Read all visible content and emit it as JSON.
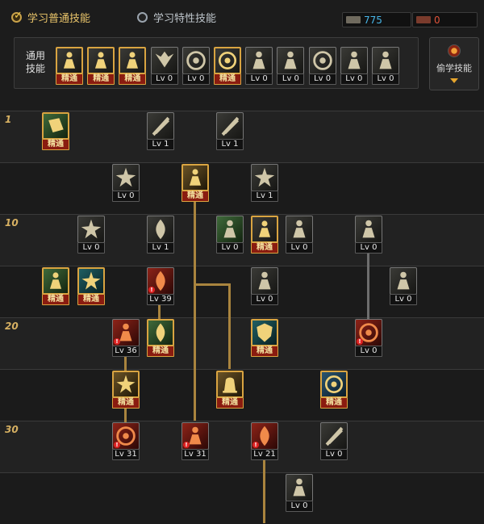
{
  "tabs": [
    {
      "label": "学习普通技能",
      "active": true
    },
    {
      "label": "学习特性技能",
      "active": false
    }
  ],
  "currency": {
    "sp_label": "SP",
    "sp_value": "775",
    "tp_label": "TP",
    "tp_value": "0"
  },
  "common_skills": {
    "title": "通用技能",
    "items": [
      {
        "icon": "seated-meditation-icon",
        "badge": "精通"
      },
      {
        "icon": "crouch-stance-icon",
        "badge": "精通"
      },
      {
        "icon": "dash-runner-icon",
        "badge": "精通"
      },
      {
        "icon": "wings-icon",
        "badge": "Lv 0"
      },
      {
        "icon": "crosshair-icon",
        "badge": "Lv 0"
      },
      {
        "icon": "green-sigil-icon",
        "badge": "精通"
      },
      {
        "icon": "figure-burst-icon",
        "badge": "Lv 0"
      },
      {
        "icon": "summon-icon",
        "badge": "Lv 0"
      },
      {
        "icon": "ring-target-icon",
        "badge": "Lv 0"
      },
      {
        "icon": "strongman-icon",
        "badge": "Lv 0"
      },
      {
        "icon": "leap-figure-icon",
        "badge": "Lv 0"
      }
    ]
  },
  "steal_button": {
    "label": "偷学技能"
  },
  "level_markers": [
    "1",
    "10",
    "20",
    "30"
  ],
  "tree": [
    {
      "icon": "green-book-icon",
      "badge": "精通",
      "color": "#3f6a3a"
    },
    {
      "icon": "kick-slash-icon",
      "badge": "Lv 1",
      "color": "#3a3a36"
    },
    {
      "icon": "slash-lines-icon",
      "badge": "Lv 1",
      "color": "#3a3a36"
    },
    {
      "icon": "spiral-icon",
      "badge": "Lv 0",
      "color": "#3a3a36"
    },
    {
      "icon": "golden-guard-icon",
      "badge": "精通",
      "color": "#6a5326"
    },
    {
      "icon": "shatter-icon",
      "badge": "Lv 1",
      "color": "#3a3a36"
    },
    {
      "icon": "spark-burst-icon",
      "badge": "Lv 0",
      "color": "#3a3a36"
    },
    {
      "icon": "rising-flame-icon",
      "badge": "Lv 1",
      "color": "#3a3a36"
    },
    {
      "icon": "armor-body-icon",
      "badge": "Lv 0",
      "color": "#3f6a3a"
    },
    {
      "icon": "sprint-icon",
      "badge": "精通",
      "color": "#3a3a36"
    },
    {
      "icon": "crouch-strike-icon",
      "badge": "Lv 0",
      "color": "#3a3a36"
    },
    {
      "icon": "side-kick-icon",
      "badge": "Lv 0",
      "color": "#3a3a36"
    },
    {
      "icon": "green-aura-icon",
      "badge": "精通",
      "color": "#3f6a3a"
    },
    {
      "icon": "green-star-icon",
      "badge": "精通",
      "color": "#1f5f63"
    },
    {
      "icon": "fire-blast-icon",
      "badge": "Lv 39",
      "color": "#8d2318"
    },
    {
      "icon": "lightning-fighter-icon",
      "badge": "Lv 0",
      "color": "#3a3a36"
    },
    {
      "icon": "crescent-kick-icon",
      "badge": "Lv 0",
      "color": "#3a3a36"
    },
    {
      "icon": "red-dash-icon",
      "badge": "Lv 36",
      "color": "#8d2318"
    },
    {
      "icon": "green-fish-icon",
      "badge": "精通",
      "color": "#3f6a3a"
    },
    {
      "icon": "teal-shield-icon",
      "badge": "精通",
      "color": "#1f5f63"
    },
    {
      "icon": "red-vortex-icon",
      "badge": "Lv 0",
      "color": "#8d2318"
    },
    {
      "icon": "golden-swirl-icon",
      "badge": "精通",
      "color": "#6a5326"
    },
    {
      "icon": "golden-bell-icon",
      "badge": "精通",
      "color": "#6a5326"
    },
    {
      "icon": "blue-counter-icon",
      "badge": "精通",
      "color": "#2a5570"
    },
    {
      "icon": "red-whirlwind-icon",
      "badge": "Lv 31",
      "color": "#8d2318"
    },
    {
      "icon": "red-pagoda-icon",
      "badge": "Lv 31",
      "color": "#8d2318"
    },
    {
      "icon": "red-comet-icon",
      "badge": "Lv 21",
      "color": "#8d2318"
    },
    {
      "icon": "slide-kick-icon",
      "badge": "Lv 0",
      "color": "#3a3a36"
    },
    {
      "icon": "golden-armor-icon",
      "badge": "Lv 0",
      "color": "#3a3a36"
    }
  ]
}
